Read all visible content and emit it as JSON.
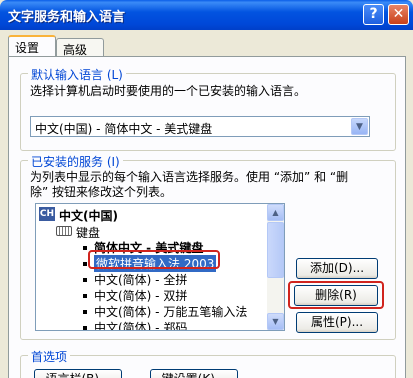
{
  "window": {
    "title": "文字服务和输入语言",
    "help_label": "?",
    "close_label": "✕"
  },
  "tabs": [
    {
      "label": "设置",
      "active": true
    },
    {
      "label": "高级",
      "active": false
    }
  ],
  "default_language": {
    "group_label": "默认输入语言 (L)",
    "description": "选择计算机启动时要使用的一个已安装的输入语言。",
    "selected_value": "中文(中国) - 简体中文 - 美式键盘"
  },
  "installed_services": {
    "group_label": "已安装的服务 (I)",
    "description_line1": "为列表中显示的每个输入语言选择服务。使用 “添加” 和 “删",
    "description_line2": "除” 按钮来修改这个列表。",
    "tree": {
      "language_badge": "CH",
      "language": "中文(中国)",
      "keyboard_label": "键盘",
      "items": [
        "简体中文 - 美式键盘",
        "微软拼音输入法 2003",
        "中文(简体) - 全拼",
        "中文(简体) - 双拼",
        "中文(简体) - 万能五笔输入法",
        "中文(简体) - 郑码"
      ]
    },
    "buttons": {
      "add": "添加(D)...",
      "remove": "删除(R)",
      "properties": "属性(P)..."
    }
  },
  "preferences": {
    "group_label": "首选项",
    "language_bar_button": "语言栏(B)...",
    "key_settings_button": "键设置(K)..."
  },
  "colors": {
    "titlebar": "#0054e3",
    "group_label": "#0046d5",
    "highlight_ring": "#d0241e",
    "dialog_bg": "#ece9d8"
  }
}
